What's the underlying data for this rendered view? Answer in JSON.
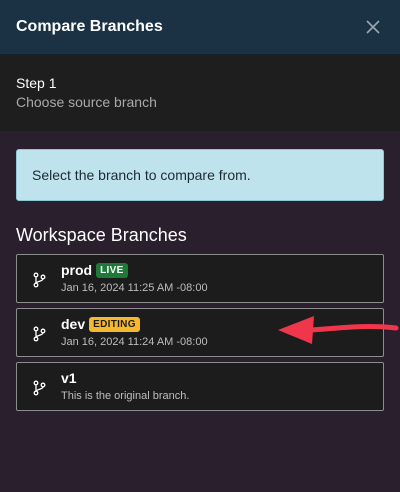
{
  "header": {
    "title": "Compare Branches",
    "close_icon": "close-icon"
  },
  "step": {
    "label": "Step 1",
    "description": "Choose source branch"
  },
  "info": {
    "message": "Select the branch to compare from."
  },
  "branches_section": {
    "title": "Workspace Branches",
    "items": [
      {
        "name": "prod",
        "badge": "LIVE",
        "subtitle": "Jan 16, 2024 11:25 AM -08:00",
        "icon": "git-branch-icon"
      },
      {
        "name": "dev",
        "badge": "EDITING",
        "subtitle": "Jan 16, 2024 11:24 AM -08:00",
        "icon": "git-branch-icon"
      },
      {
        "name": "v1",
        "subtitle": "This is the original branch.",
        "icon": "git-branch-icon"
      }
    ]
  },
  "colors": {
    "header_bg": "#1b3245",
    "body_bg": "#2a1f2d",
    "info_bg": "#bfe3ec",
    "live_badge": "#1f7a3a",
    "editing_badge": "#f5b82e",
    "arrow": "#f0364a"
  }
}
